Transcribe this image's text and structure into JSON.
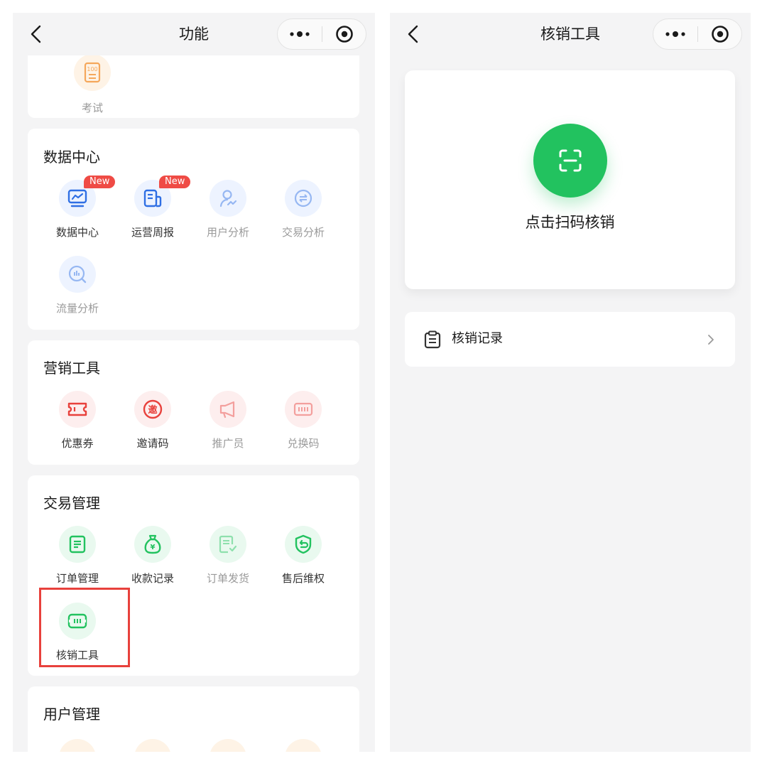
{
  "left": {
    "nav": {
      "title": "功能"
    },
    "exam": {
      "label": "考试",
      "icon": "exam-icon"
    },
    "sections": [
      {
        "title": "数据中心",
        "items": [
          {
            "label": "数据中心",
            "badge": "New",
            "icon": "chart-monitor-icon"
          },
          {
            "label": "运营周报",
            "badge": "New",
            "icon": "report-icon"
          },
          {
            "label": "用户分析",
            "icon": "user-analysis-icon"
          },
          {
            "label": "交易分析",
            "icon": "trade-analysis-icon"
          },
          {
            "label": "流量分析",
            "icon": "traffic-analysis-icon"
          }
        ]
      },
      {
        "title": "营销工具",
        "items": [
          {
            "label": "优惠券",
            "icon": "coupon-icon"
          },
          {
            "label": "邀请码",
            "icon": "invite-icon",
            "glyph": "邀"
          },
          {
            "label": "推广员",
            "icon": "megaphone-icon"
          },
          {
            "label": "兑换码",
            "icon": "redeem-code-icon"
          }
        ]
      },
      {
        "title": "交易管理",
        "items": [
          {
            "label": "订单管理",
            "icon": "order-icon"
          },
          {
            "label": "收款记录",
            "icon": "money-bag-icon",
            "glyph": "¥"
          },
          {
            "label": "订单发货",
            "icon": "shipping-icon"
          },
          {
            "label": "售后维权",
            "icon": "shield-icon"
          },
          {
            "label": "核销工具",
            "icon": "verify-tool-icon"
          }
        ]
      },
      {
        "title": "用户管理"
      }
    ]
  },
  "right": {
    "nav": {
      "title": "核销工具"
    },
    "scan": {
      "label": "点击扫码核销"
    },
    "record": {
      "label": "核销记录"
    }
  },
  "colors": {
    "green": "#22c25f",
    "blue": "#2f6fe4",
    "red": "#ef4b45",
    "orange": "#f5a75b",
    "highlight": "#e8413c"
  }
}
